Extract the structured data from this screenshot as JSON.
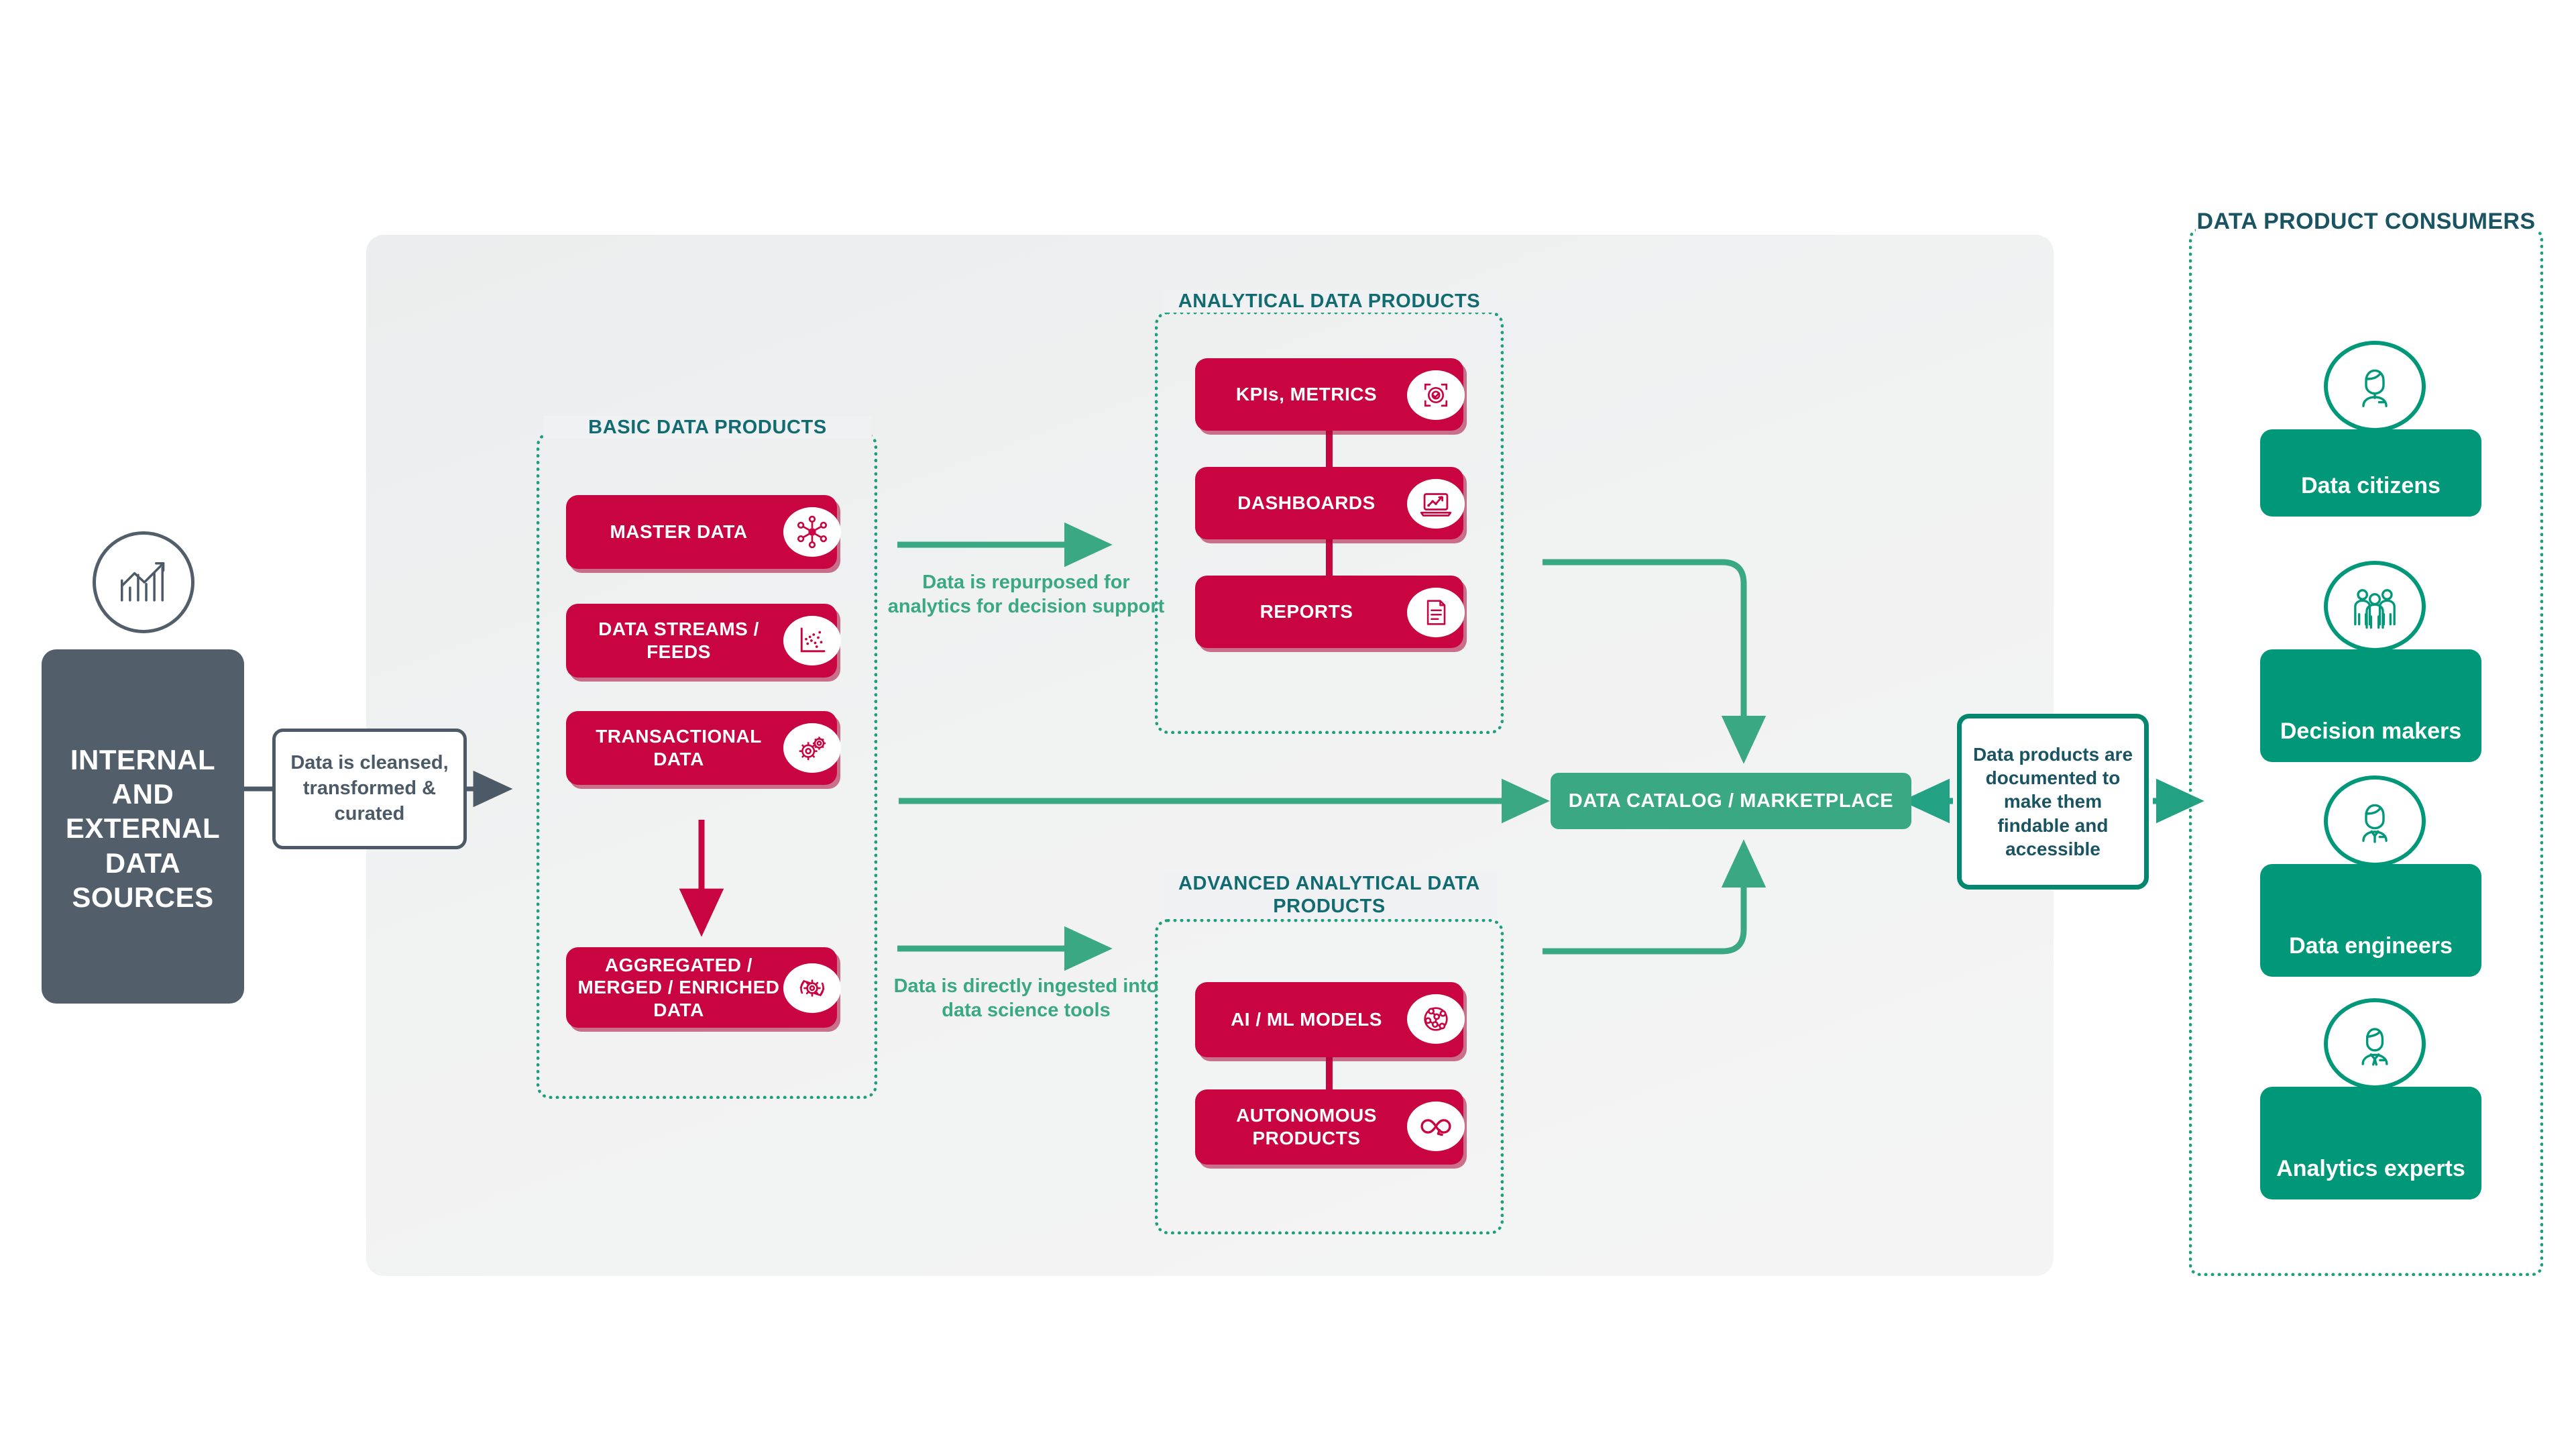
{
  "source": {
    "label": "INTERNAL AND EXTERNAL DATA SOURCES",
    "icon": "bar-chart-growth-icon"
  },
  "cleanse_note": {
    "text": "Data is cleansed, transformed & curated"
  },
  "groups": {
    "basic": {
      "title": "BASIC DATA PRODUCTS",
      "items": [
        {
          "label": "MASTER DATA",
          "icon": "network-hub-icon"
        },
        {
          "label": "DATA STREAMS / FEEDS",
          "icon": "scatter-plot-icon"
        },
        {
          "label": "TRANSACTIONAL DATA",
          "icon": "gears-icon"
        },
        {
          "label": "AGGREGATED / MERGED / ENRICHED DATA",
          "icon": "gear-refresh-icon"
        }
      ]
    },
    "analytical": {
      "title": "ANALYTICAL DATA PRODUCTS",
      "items": [
        {
          "label": "KPIs, METRICS",
          "icon": "target-check-icon"
        },
        {
          "label": "DASHBOARDS",
          "icon": "laptop-chart-icon"
        },
        {
          "label": "REPORTS",
          "icon": "document-icon"
        }
      ]
    },
    "advanced": {
      "title": "ADVANCED ANALYTICAL DATA PRODUCTS",
      "items": [
        {
          "label": "AI / ML MODELS",
          "icon": "neural-network-icon"
        },
        {
          "label": "AUTONOMOUS PRODUCTS",
          "icon": "infinity-loop-icon"
        }
      ]
    },
    "consumers": {
      "title": "DATA PRODUCT CONSUMERS",
      "items": [
        {
          "label": "Data citizens",
          "icon": "person-female-icon"
        },
        {
          "label": "Decision makers",
          "icon": "people-group-icon"
        },
        {
          "label": "Data engineers",
          "icon": "person-engineer-icon"
        },
        {
          "label": "Analytics experts",
          "icon": "person-suit-icon"
        }
      ]
    }
  },
  "catalog": {
    "label": "DATA CATALOG / MARKETPLACE"
  },
  "doc_note": {
    "text": "Data products are documented to make them findable and accessible"
  },
  "annotations": {
    "repurposed": "Data is repurposed for analytics for decision support",
    "ingested": "Data is directly ingested into data science tools"
  },
  "colors": {
    "red": "#C80540",
    "teal_dark": "#1A5462",
    "green_card": "#009878",
    "green_bar": "#3AA883",
    "green_dotted": "#1E9E7C",
    "slate": "#525F6B",
    "panel_gray": "#F1F2F2"
  }
}
